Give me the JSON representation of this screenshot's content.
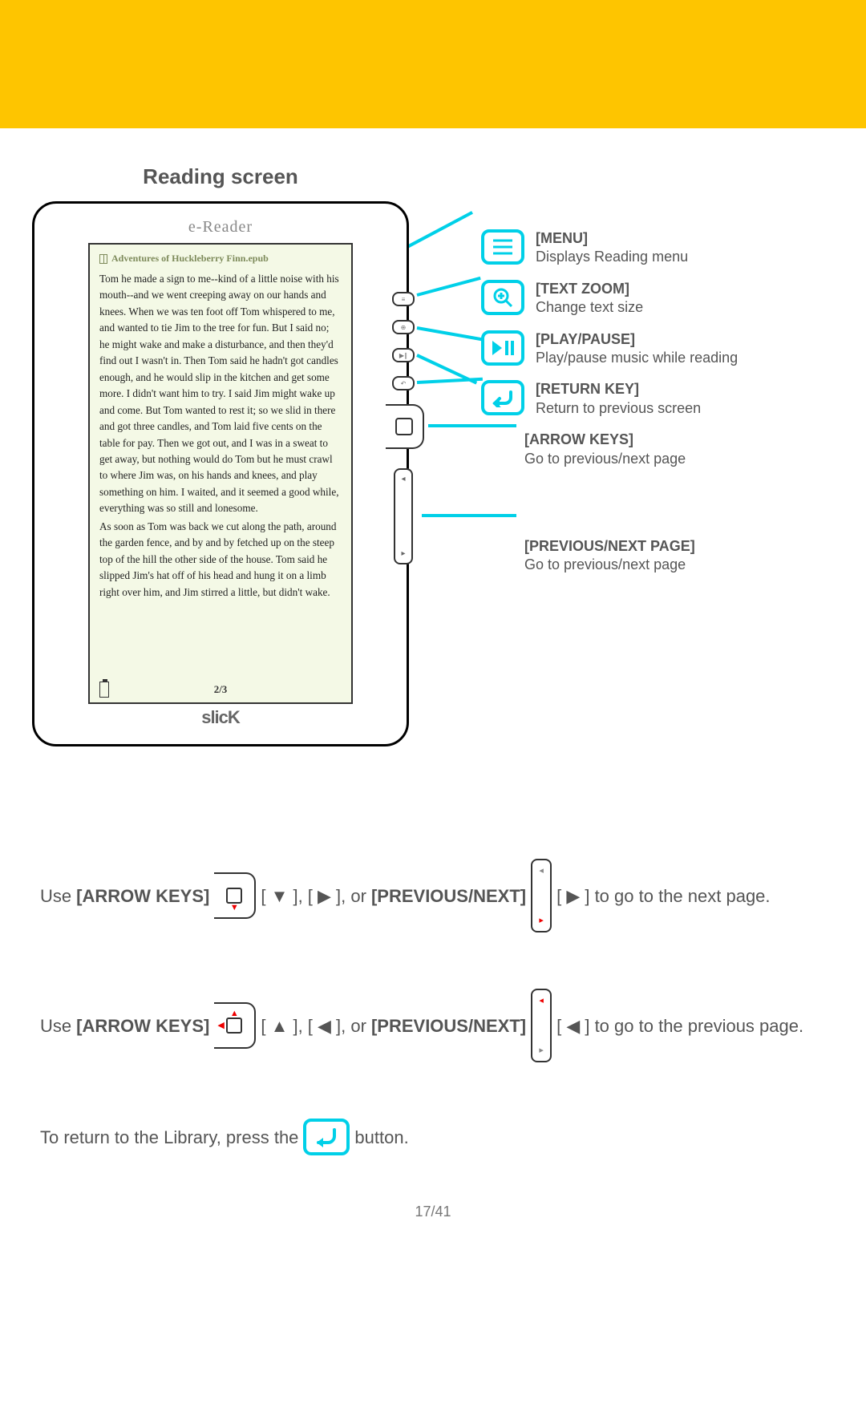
{
  "title": "Reading screen",
  "device": {
    "topLabel": "e-Reader",
    "brand": "slicK",
    "bookTitle": "Adventures of Huckleberry Finn.epub",
    "para1": "Tom he made a sign to me--kind of a little noise with his mouth--and we went creeping away on our hands and knees. When we was ten foot off Tom whispered to me, and wanted to tie Jim to the tree for fun. But I said no; he might wake and make a disturbance, and then they'd find out I wasn't in. Then Tom said he hadn't got candles enough, and he would slip in the kitchen and get some more. I didn't want him to try. I said Jim might wake up and come. But Tom wanted to rest it; so we slid in there and got three candles, and Tom laid five cents on the table for pay. Then we got out, and I was in a sweat to get away, but nothing would do Tom but he must crawl to where Jim was, on his hands and knees, and play something on him. I waited, and it seemed a good while, everything was so still and lonesome.",
    "para2": "As soon as Tom was back we cut along the path, around the garden fence, and by and by fetched up on the steep top of the hill the other side of the house. Tom said he slipped Jim's hat off of his head and hung it on a limb right over him, and Jim stirred a little, but didn't wake.",
    "pageCounter": "2/3"
  },
  "callouts": {
    "menu": {
      "label": "[MENU]",
      "desc": "Displays Reading menu"
    },
    "zoom": {
      "label": "[TEXT ZOOM]",
      "desc": "Change text size"
    },
    "play": {
      "label": "[PLAY/PAUSE]",
      "desc": "Play/pause music while reading"
    },
    "return": {
      "label": "[RETURN KEY]",
      "desc": "Return to previous screen"
    },
    "arrows": {
      "label": "[ARROW KEYS]",
      "desc": "Go to previous/next page"
    },
    "prevnext": {
      "label": "[PREVIOUS/NEXT PAGE]",
      "desc": "Go to previous/next page"
    }
  },
  "instructions": {
    "l1a": "Use ",
    "l1b": "[ARROW KEYS]",
    "l1c": " [ ▼ ], [ ▶ ], or ",
    "l1d": "[PREVIOUS/NEXT]",
    "l1e": " [ ▶ ] to go to the next page.",
    "l2a": "Use ",
    "l2b": "[ARROW KEYS]",
    "l2c": " [ ▲ ], [ ◀ ], or ",
    "l2d": "[PREVIOUS/NEXT]",
    "l2e": " [ ◀ ] to go to the previous page.",
    "l3a": "To return to the Library, press the ",
    "l3b": " button."
  },
  "footer": "17/41"
}
